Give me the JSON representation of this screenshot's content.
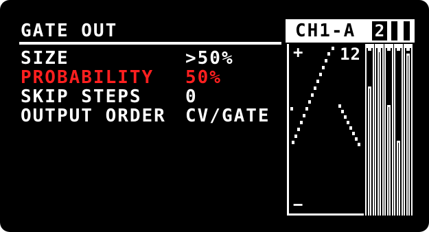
{
  "menu": {
    "title": "GATE OUT",
    "rows": [
      {
        "label": "SIZE",
        "value": ">50%",
        "color": "#ffffff"
      },
      {
        "label": "PROBABILITY",
        "value": "50%",
        "color": "#ff1f1f"
      },
      {
        "label": "SKIP STEPS",
        "value": "0",
        "color": "#ffffff"
      },
      {
        "label": "OUTPUT ORDER",
        "value": "CV/GATE",
        "color": "#ffffff"
      }
    ]
  },
  "panel": {
    "channel": "CH1-A",
    "page": "2",
    "scale_value": "12",
    "plus_icon": "+",
    "minus_icon": "−"
  },
  "meters": {
    "levels": [
      0.77,
      0.99,
      0.66,
      0.44,
      0.97
    ]
  },
  "colors": {
    "background": "#000000",
    "foreground": "#ffffff",
    "accent": "#ff1f1f"
  }
}
